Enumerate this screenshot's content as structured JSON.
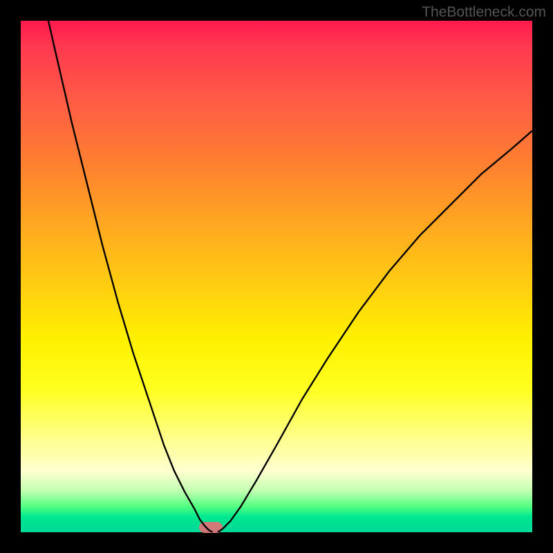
{
  "watermark": "TheBottleneck.com",
  "chart_data": {
    "type": "line",
    "title": "",
    "xlabel": "",
    "ylabel": "",
    "xlim": [
      0,
      100
    ],
    "ylim": [
      0,
      100
    ],
    "series": [
      {
        "name": "curve-left",
        "x": [
          5.4,
          7,
          10,
          13,
          16,
          19,
          22,
          25,
          28,
          30,
          32,
          34,
          35,
          36,
          36.8,
          37.5
        ],
        "y": [
          100,
          93,
          80,
          68,
          56,
          45,
          35,
          26,
          17,
          12,
          8,
          4.5,
          2.5,
          1.2,
          0.4,
          0
        ]
      },
      {
        "name": "curve-right",
        "x": [
          38.5,
          39.5,
          41,
          43,
          46,
          50,
          55,
          60,
          66,
          72,
          78,
          84,
          90,
          96,
          100
        ],
        "y": [
          0,
          0.7,
          2.2,
          5,
          10,
          17,
          26,
          34,
          43,
          51,
          58,
          64,
          70,
          75,
          78.5
        ]
      }
    ],
    "marker": {
      "x": 37.2,
      "y": 0
    },
    "gradient": {
      "top": "#ff1a4d",
      "mid": "#fff000",
      "bottom": "#00d898"
    }
  }
}
